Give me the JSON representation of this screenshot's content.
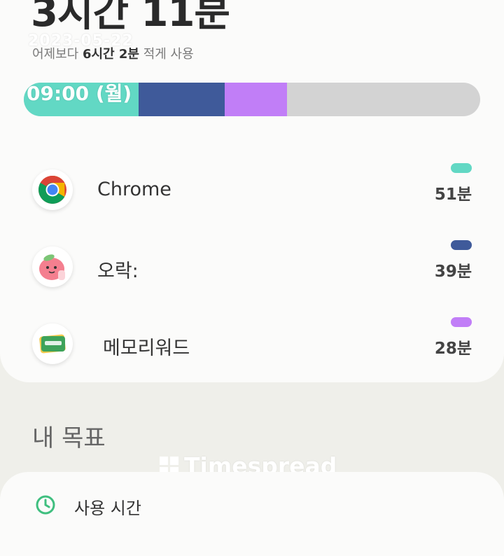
{
  "summary": {
    "total_time": "3시간 11분",
    "compare_prefix": "어제보다 ",
    "compare_amount": "6시간 2분",
    "compare_suffix": " 적게 사용"
  },
  "watermark": {
    "date": "2023-05-22",
    "time": "09:00 (월)",
    "brand": "Timespread"
  },
  "usage_bar": {
    "segments": [
      {
        "app": "Chrome",
        "minutes": 51,
        "color": "#62d8c4"
      },
      {
        "app": "오락:",
        "minutes": 39,
        "color": "#3f5a9a"
      },
      {
        "app": "메모리워드",
        "minutes": 28,
        "color": "#c17ef7"
      }
    ],
    "remainder_color": "#d3d3d3"
  },
  "apps": [
    {
      "name": "Chrome",
      "time": "51분",
      "color": "#62d8c4",
      "icon": "chrome-icon"
    },
    {
      "name": "오락:",
      "time": "39분",
      "color": "#3f5a9a",
      "icon": "peach-character-icon"
    },
    {
      "name": "메모리워드",
      "time": "28분",
      "color": "#c17ef7",
      "icon": "memoryword-card-icon"
    }
  ],
  "goals": {
    "title": "내 목표",
    "first_item_label": "사용 시간",
    "first_item_icon": "timer-icon"
  }
}
